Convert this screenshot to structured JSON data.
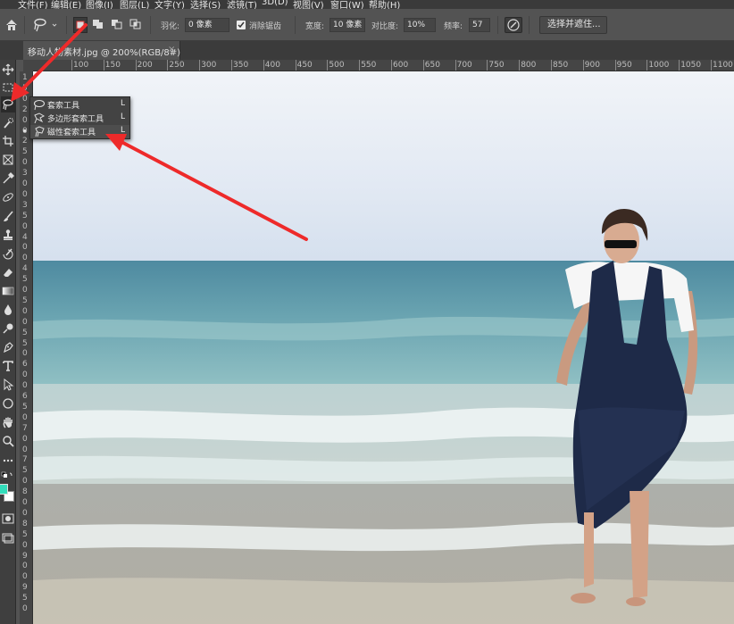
{
  "menu": [
    "文件(F)",
    "编辑(E)",
    "图像(I)",
    "图层(L)",
    "文字(Y)",
    "选择(S)",
    "滤镜(T)",
    "3D(D)",
    "视图(V)",
    "窗口(W)",
    "帮助(H)"
  ],
  "options": {
    "feather_label": "羽化:",
    "feather_value": "0 像素",
    "antialias_label": "消除锯齿",
    "antialias_checked": true,
    "width_label": "宽度:",
    "width_value": "10 像素",
    "contrast_label": "对比度:",
    "contrast_value": "10%",
    "frequency_label": "频率:",
    "frequency_value": "57",
    "select_mask_label": "选择并遮住..."
  },
  "document_tab": {
    "title": "移动人物素材.jpg @ 200%(RGB/8#)",
    "close": "×"
  },
  "ruler_h": [
    "100",
    "150",
    "200",
    "250",
    "300",
    "350",
    "400",
    "450",
    "500",
    "550",
    "600",
    "650",
    "700",
    "750",
    "800",
    "850",
    "900",
    "950",
    "1000",
    "1050",
    "1100"
  ],
  "ruler_v": [
    "1",
    "5",
    "0",
    "2",
    "0",
    "0",
    "2",
    "5",
    "0",
    "3",
    "0",
    "0",
    "3",
    "5",
    "0",
    "4",
    "0",
    "0",
    "4",
    "5",
    "0",
    "5",
    "0",
    "0",
    "5",
    "5",
    "0",
    "6",
    "0",
    "0",
    "6",
    "5",
    "0",
    "7",
    "0",
    "0",
    "7",
    "5",
    "0",
    "8",
    "0",
    "0",
    "8",
    "5",
    "0",
    "9",
    "0",
    "0",
    "9",
    "5",
    "0"
  ],
  "flyout": {
    "items": [
      {
        "label": "套索工具",
        "key": "L",
        "icon": "lasso-icon"
      },
      {
        "label": "多边形套索工具",
        "key": "L",
        "icon": "polygonal-lasso-icon"
      },
      {
        "label": "磁性套索工具",
        "key": "L",
        "icon": "magnetic-lasso-icon"
      }
    ]
  },
  "colors": {
    "foreground": "#33ddbb",
    "background": "#ffffff",
    "arrow": "#ee2a2a"
  }
}
